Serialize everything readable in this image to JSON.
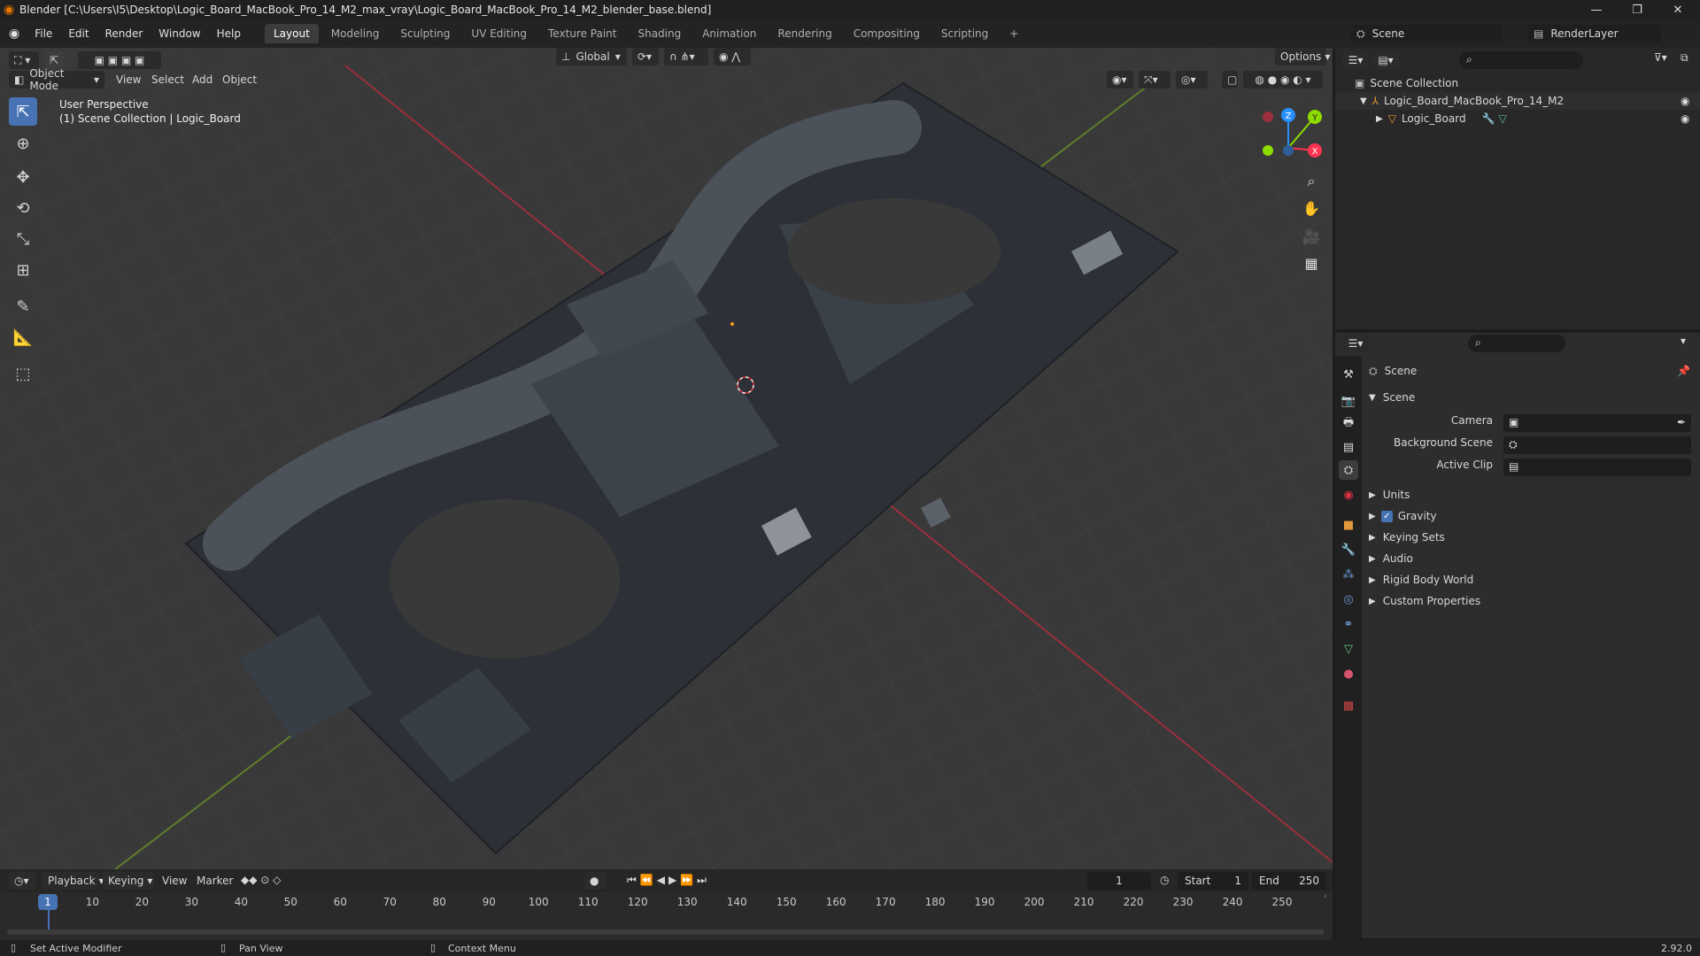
{
  "window": {
    "title": "Blender [C:\\Users\\I5\\Desktop\\Logic_Board_MacBook_Pro_14_M2_max_vray\\Logic_Board_MacBook_Pro_14_M2_blender_base.blend]"
  },
  "menus": [
    "File",
    "Edit",
    "Render",
    "Window",
    "Help"
  ],
  "workspaces": [
    "Layout",
    "Modeling",
    "Sculpting",
    "UV Editing",
    "Texture Paint",
    "Shading",
    "Animation",
    "Rendering",
    "Compositing",
    "Scripting"
  ],
  "active_workspace": "Layout",
  "scene_selector": {
    "label": "Scene"
  },
  "renderlayer_selector": {
    "label": "RenderLayer"
  },
  "viewport": {
    "mode": "Object Mode",
    "menus": [
      "View",
      "Select",
      "Add",
      "Object"
    ],
    "transform_orientation": "Global",
    "options_label": "Options",
    "overlay_line1": "User Perspective",
    "overlay_line2": "(1) Scene Collection | Logic_Board",
    "gizmo_axes": {
      "z": "Z",
      "y": "Y",
      "x": "X"
    }
  },
  "outliner": {
    "root": "Scene Collection",
    "items": [
      {
        "label": "Logic_Board_MacBook_Pro_14_M2"
      },
      {
        "label": "Logic_Board"
      }
    ]
  },
  "properties": {
    "header": "Scene",
    "section": "Scene",
    "fields": [
      {
        "label": "Camera"
      },
      {
        "label": "Background Scene"
      },
      {
        "label": "Active Clip"
      }
    ],
    "panels": [
      "Units",
      "Gravity",
      "Keying Sets",
      "Audio",
      "Rigid Body World",
      "Custom Properties"
    ],
    "gravity_checked": true
  },
  "timeline": {
    "menus": [
      "Playback",
      "Keying",
      "View",
      "Marker"
    ],
    "current_frame": "1",
    "start_label": "Start",
    "start_value": "1",
    "end_label": "End",
    "end_value": "250",
    "ruler": [
      "1",
      "10",
      "20",
      "30",
      "40",
      "50",
      "60",
      "70",
      "80",
      "90",
      "100",
      "110",
      "120",
      "130",
      "140",
      "150",
      "160",
      "170",
      "180",
      "190",
      "200",
      "210",
      "220",
      "230",
      "240",
      "250"
    ]
  },
  "statusbar": {
    "hint1": "Set Active Modifier",
    "hint2": "Pan View",
    "hint3": "Context Menu",
    "version": "2.92.0"
  },
  "colors": {
    "accent": "#4772b3",
    "x_axis": "#ff3352",
    "y_axis": "#8bdc00",
    "z_axis": "#2890ff"
  }
}
